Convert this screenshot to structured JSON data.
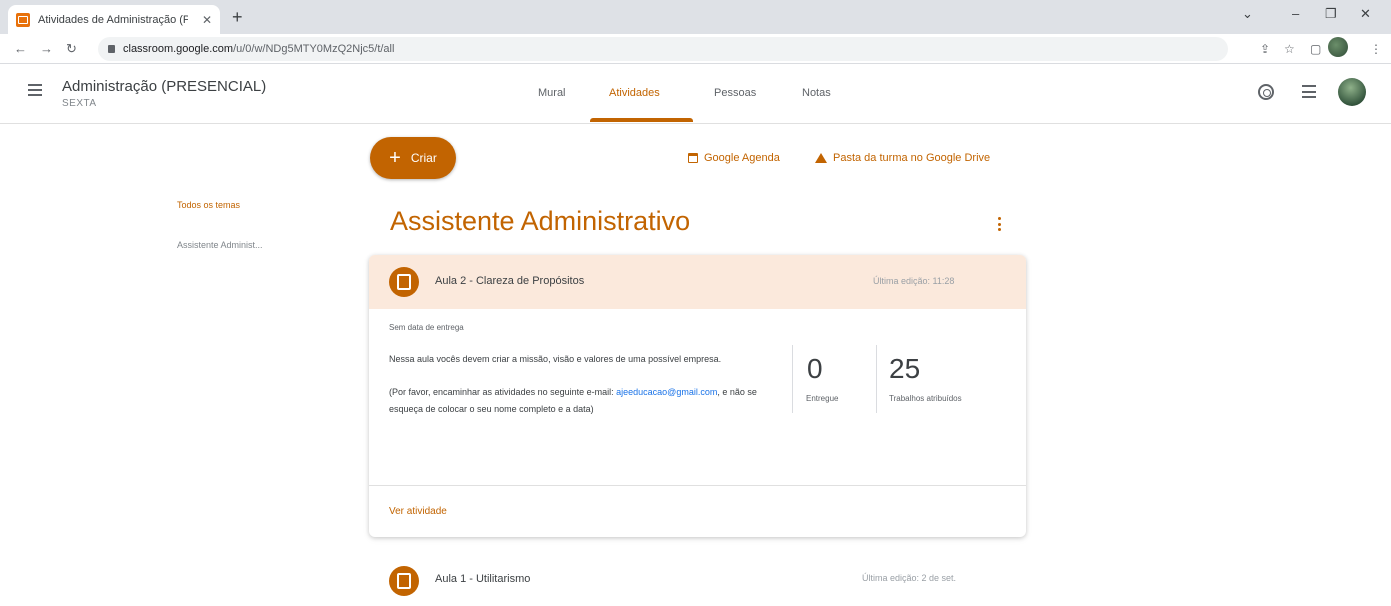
{
  "browser": {
    "tab_title": "Atividades de Administração (PI",
    "tab_close": "✕",
    "new_tab": "+",
    "url_host": "classroom.google.com",
    "url_path": "/u/0/w/NDg5MTY0MzQ2Njc5/t/all",
    "controls": {
      "minimize": "–",
      "restore": "❐",
      "close": "✕",
      "dropdown": "⌄"
    }
  },
  "header": {
    "class_title": "Administração (PRESENCIAL)",
    "class_sub": "SEXTA",
    "tabs": [
      {
        "label": "Mural"
      },
      {
        "label": "Atividades"
      },
      {
        "label": "Pessoas"
      },
      {
        "label": "Notas"
      }
    ]
  },
  "toolbar": {
    "create_label": "Criar",
    "calendar_label": "Google Agenda",
    "drive_label": "Pasta da turma no Google Drive"
  },
  "sidebar": {
    "items": [
      {
        "label": "Todos os temas"
      },
      {
        "label": "Assistente Administ..."
      }
    ]
  },
  "topic": {
    "title": "Assistente Administrativo"
  },
  "assignments": [
    {
      "title": "Aula 2 - Clareza de Propósitos",
      "edited": "Última edição: 11:28",
      "due": "Sem data de entrega",
      "description_1": "Nessa aula vocês devem criar a missão, visão e valores de uma possível empresa.",
      "description_2_pre": "(Por favor, encaminhar as atividades no seguinte e-mail:",
      "email": "ajeeducacao@gmail.com",
      "description_2_post": ", e não se esqueça de colocar o seu nome completo e a data)",
      "handed_in": "0",
      "handed_in_label": "Entregue",
      "assigned": "25",
      "assigned_label": "Trabalhos atribuídos",
      "view_label": "Ver atividade"
    },
    {
      "title": "Aula 1 - Utilitarismo",
      "edited": "Última edição: 2 de set."
    }
  ]
}
